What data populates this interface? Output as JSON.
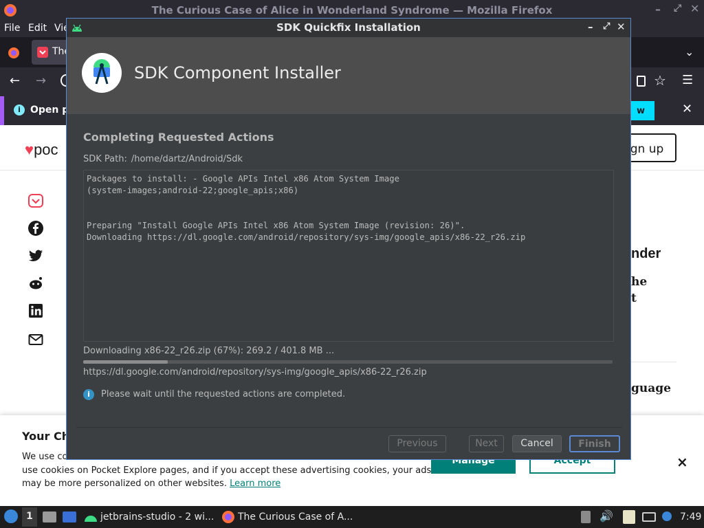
{
  "firefox": {
    "window_title": "The Curious Case of Alice in Wonderland Syndrome — Mozilla Firefox",
    "menu": [
      "File",
      "Edit",
      "Vie"
    ],
    "tab_label": "The",
    "notification_text": "Open p",
    "notification_button": "w",
    "pocket_logo_text": "poc",
    "signup_label": "ign up",
    "article_fragments": [
      "nder",
      "he",
      "t",
      "guage"
    ]
  },
  "consent": {
    "title": "Your Ch",
    "line1": "We use co",
    "line2": "use cookies on Pocket Explore pages, and if you accept these advertising cookies, your ads",
    "line3": "may be more personalized on other websites.",
    "learn_more": "Learn more",
    "manage_label": "Manage",
    "accept_label": "Accept",
    "close": "×"
  },
  "dialog": {
    "title": "SDK Quickfix Installation",
    "header_title": "SDK Component Installer",
    "section_title": "Completing Requested Actions",
    "sdk_path_label": "SDK Path:",
    "sdk_path_value": "/home/dartz/Android/Sdk",
    "log": "Packages to install: - Google APIs Intel x86 Atom System Image\n(system-images;android-22;google_apis;x86)\n\n\nPreparing \"Install Google APIs Intel x86 Atom System Image (revision: 26)\".\nDownloading https://dl.google.com/android/repository/sys-img/google_apis/x86-22_r26.zip",
    "progress_label": "Downloading x86-22_r26.zip (67%): 269.2 / 401.8 MB ...",
    "progress_fraction": 0.16,
    "progress_url": "https://dl.google.com/android/repository/sys-img/google_apis/x86-22_r26.zip",
    "info_text": "Please wait until the requested actions are completed.",
    "buttons": {
      "previous": "Previous",
      "next": "Next",
      "cancel": "Cancel",
      "finish": "Finish"
    }
  },
  "taskbar": {
    "workspace": "1",
    "tasks": [
      "jetbrains-studio - 2 wi...",
      "The Curious Case of A..."
    ],
    "clock": "7:49"
  }
}
